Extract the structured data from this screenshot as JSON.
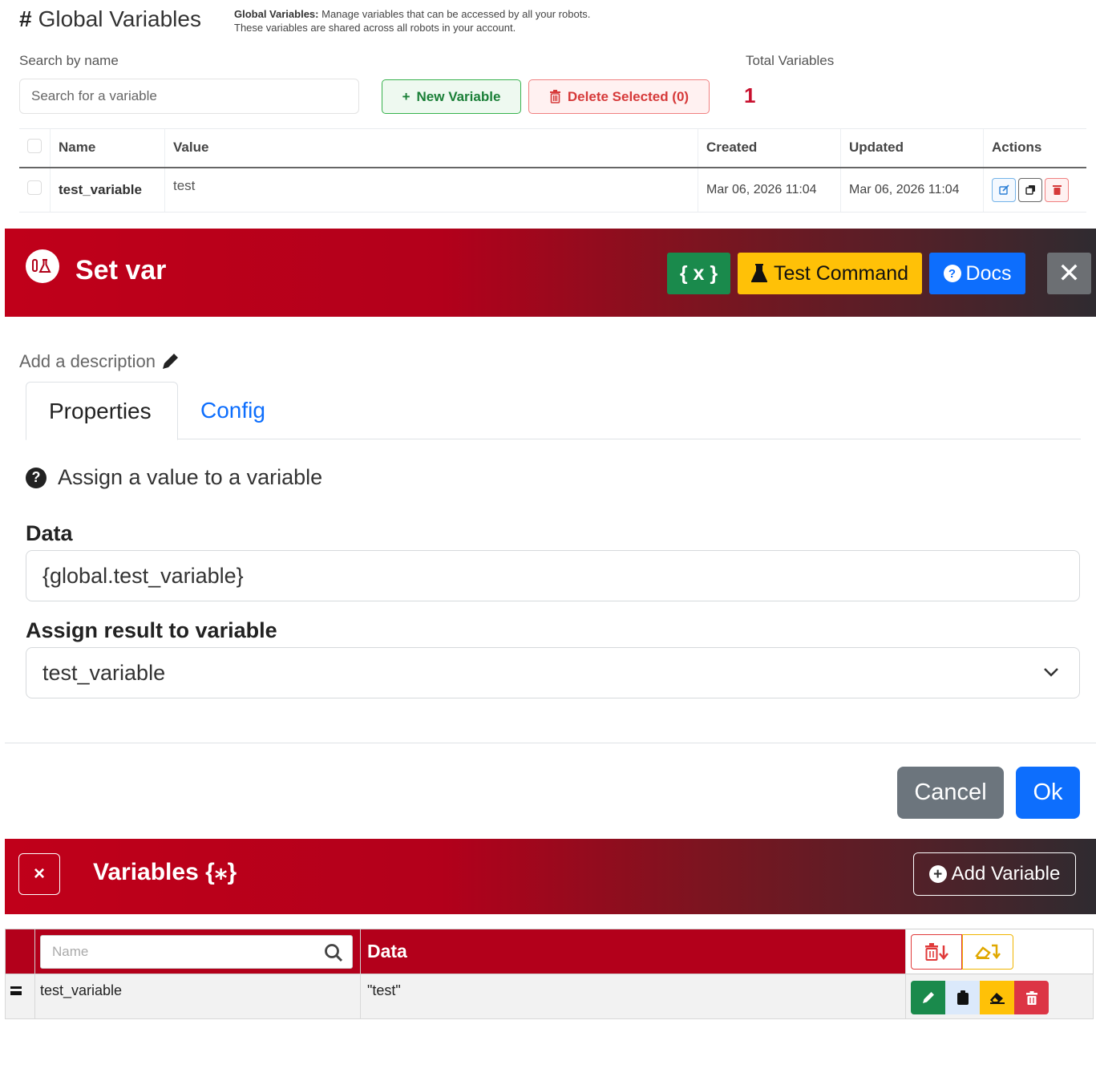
{
  "global_variables": {
    "title": "Global Variables",
    "description_bold": "Global Variables:",
    "description_line1": " Manage variables that can be accessed by all your robots.",
    "description_line2": "These variables are shared across all robots in your account.",
    "search_label": "Search by name",
    "search_placeholder": "Search for a variable",
    "new_variable_label": "New Variable",
    "delete_selected_label": "Delete Selected (0)",
    "total_label": "Total Variables",
    "total_value": "1",
    "columns": [
      "Name",
      "Value",
      "Created",
      "Updated",
      "Actions"
    ],
    "rows": [
      {
        "name": "test_variable",
        "value": "test",
        "created": "Mar 06, 2026 11:04",
        "updated": "Mar 06, 2026 11:04"
      }
    ]
  },
  "set_var_modal": {
    "title": "Set var",
    "var_button": "{ x }",
    "test_command_label": "Test Command",
    "docs_label": "Docs",
    "close_symbol": "✕",
    "description_prompt": "Add a description",
    "tabs": [
      "Properties",
      "Config"
    ],
    "help_text": "Assign a value to a variable",
    "data_label": "Data",
    "data_value": "{global.test_variable}",
    "assign_label": "Assign result to variable",
    "assign_value": "test_variable",
    "cancel_label": "Cancel",
    "ok_label": "Ok"
  },
  "variables_panel": {
    "close_symbol": "×",
    "title": "Variables {⁎}",
    "add_variable_label": "Add Variable",
    "name_placeholder": "Name",
    "data_header": "Data",
    "rows": [
      {
        "name": "test_variable",
        "data": "\"test\""
      }
    ]
  },
  "colors": {
    "brand_red": "#b3001b",
    "primary_blue": "#0d6efd",
    "success_green": "#1a8a4c",
    "warning_yellow": "#ffc107",
    "secondary_gray": "#6c757d"
  }
}
